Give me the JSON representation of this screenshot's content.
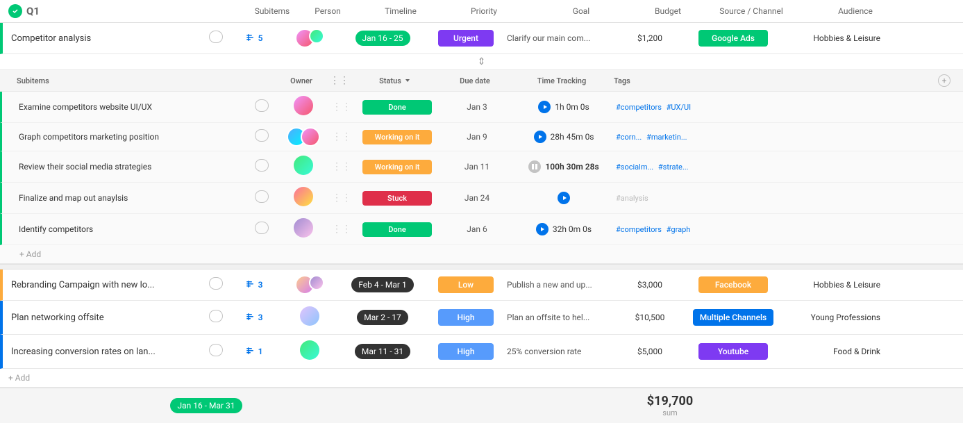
{
  "header": {
    "q1": "Q1",
    "cols": {
      "subitems": "Subitems",
      "person": "Person",
      "timeline": "Timeline",
      "priority": "Priority",
      "goal": "Goal",
      "budget": "Budget",
      "source": "Source / Channel",
      "audience": "Audience"
    }
  },
  "competitor_analysis": {
    "name": "Competitor analysis",
    "subitems_count": "5",
    "timeline": "Jan 16 - 25",
    "priority": "Urgent",
    "goal": "Clarify our main com...",
    "budget": "$1,200",
    "source": "Google Ads",
    "audience": "Hobbies & Leisure"
  },
  "subitems_cols": {
    "subitems": "Subitems",
    "owner": "Owner",
    "status": "Status",
    "duedate": "Due date",
    "tracking": "Time Tracking",
    "tags": "Tags"
  },
  "subitems": [
    {
      "name": "Examine competitors website UI/UX",
      "status": "Done",
      "status_type": "done",
      "duedate": "Jan 3",
      "tracking": "1h 0m 0s",
      "tracking_state": "play",
      "tags": [
        "#competitors",
        "#UX/UI"
      ]
    },
    {
      "name": "Graph competitors marketing position",
      "status": "Working on it",
      "status_type": "working",
      "duedate": "Jan 9",
      "tracking": "28h 45m 0s",
      "tracking_state": "play",
      "tags": [
        "#corn...",
        "#marketin..."
      ]
    },
    {
      "name": "Review their social media strategies",
      "status": "Working on it",
      "status_type": "working",
      "duedate": "Jan 11",
      "tracking": "100h 30m 28s",
      "tracking_state": "pause",
      "tags": [
        "#socialm...",
        "#strate..."
      ]
    },
    {
      "name": "Finalize and map out anaylsis",
      "status": "Stuck",
      "status_type": "stuck",
      "duedate": "Jan 24",
      "tracking": "",
      "tracking_state": "play",
      "tags": [
        "#analysis"
      ]
    },
    {
      "name": "Identify competitors",
      "status": "Done",
      "status_type": "done",
      "duedate": "Jan 6",
      "tracking": "32h 0m 0s",
      "tracking_state": "play",
      "tags": [
        "#competitors",
        "#graph"
      ]
    }
  ],
  "add_subitem": "+ Add",
  "main_tasks": [
    {
      "name": "Rebranding Campaign with new lo...",
      "subitems_count": "3",
      "timeline": "Feb 4 - Mar 1",
      "timeline_bg": "dark",
      "priority": "Low",
      "priority_type": "low",
      "goal": "Publish a new and up...",
      "budget": "$3,000",
      "source": "Facebook",
      "source_type": "facebook",
      "audience": "Hobbies & Leisure",
      "border_color": "yellow"
    },
    {
      "name": "Plan networking offsite",
      "subitems_count": "3",
      "timeline": "Mar 2 - 17",
      "timeline_bg": "dark",
      "priority": "High",
      "priority_type": "high",
      "goal": "Plan an offsite to hel...",
      "budget": "$10,500",
      "source": "Multiple Channels",
      "source_type": "multiple",
      "audience": "Young Professions",
      "border_color": "blue"
    },
    {
      "name": "Increasing conversion rates on lan...",
      "subitems_count": "1",
      "timeline": "Mar 11 - 31",
      "timeline_bg": "dark",
      "priority": "High",
      "priority_type": "high",
      "goal": "25% conversion rate",
      "budget": "$5,000",
      "source": "Youtube",
      "source_type": "youtube",
      "audience": "Food & Drink",
      "border_color": "blue"
    }
  ],
  "add_task": "+ Add",
  "footer": {
    "timeline": "Jan 16 - Mar 31",
    "budget_total": "$19,700",
    "budget_label": "sum"
  }
}
